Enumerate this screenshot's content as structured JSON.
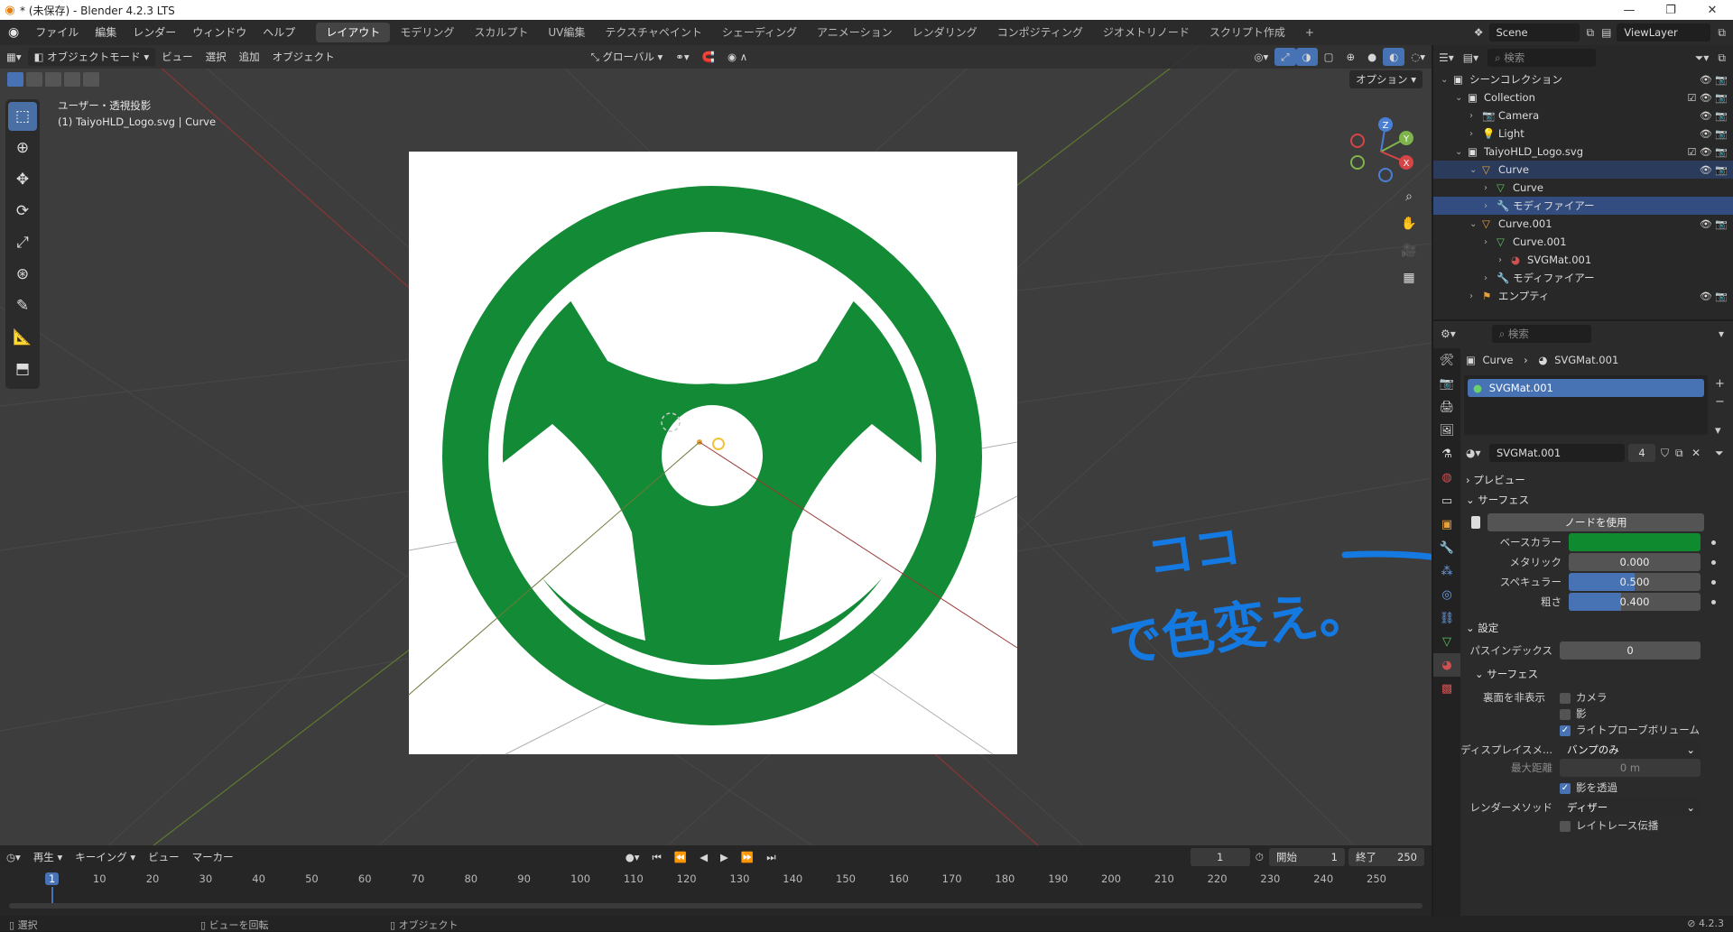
{
  "window": {
    "title": "* (未保存) - Blender 4.2.3 LTS",
    "minimize": "—",
    "maximize": "❐",
    "close": "✕"
  },
  "menu": {
    "items": [
      "ファイル",
      "編集",
      "レンダー",
      "ウィンドウ",
      "ヘルプ"
    ]
  },
  "workspaces": [
    "レイアウト",
    "モデリング",
    "スカルプト",
    "UV編集",
    "テクスチャペイント",
    "シェーディング",
    "アニメーション",
    "レンダリング",
    "コンポジティング",
    "ジオメトリノード",
    "スクリプト作成",
    "+"
  ],
  "scene": {
    "scene_name": "Scene",
    "view_layer": "ViewLayer"
  },
  "viewport": {
    "mode": "オブジェクトモード",
    "menus": [
      "ビュー",
      "選択",
      "追加",
      "オブジェクト"
    ],
    "transform_orientation": "グローバル",
    "options_label": "オプション",
    "view_name": "ユーザー・透視投影",
    "object_info": "(1) TaiyoHLD_Logo.svg | Curve",
    "logo_color": "#138a36",
    "gizmo": {
      "z": "Z",
      "y": "Y",
      "x": "X"
    }
  },
  "outliner": {
    "search_placeholder": "検索",
    "rows": [
      {
        "label": "シーンコレクション",
        "indent": 0,
        "icon": "collection-icon"
      },
      {
        "label": "Collection",
        "indent": 1,
        "icon": "collection-icon"
      },
      {
        "label": "Camera",
        "indent": 2,
        "icon": "camera-icon"
      },
      {
        "label": "Light",
        "indent": 2,
        "icon": "light-icon"
      },
      {
        "label": "TaiyoHLD_Logo.svg",
        "indent": 1,
        "icon": "collection-icon"
      },
      {
        "label": "Curve",
        "indent": 2,
        "icon": "curve-icon",
        "state": "active"
      },
      {
        "label": "Curve",
        "indent": 3,
        "icon": "curve-data-icon"
      },
      {
        "label": "モディファイアー",
        "indent": 3,
        "icon": "wrench-icon",
        "state": "selected"
      },
      {
        "label": "Curve.001",
        "indent": 2,
        "icon": "curve-icon"
      },
      {
        "label": "Curve.001",
        "indent": 3,
        "icon": "curve-data-icon"
      },
      {
        "label": "SVGMat.001",
        "indent": 4,
        "icon": "material-icon"
      },
      {
        "label": "モディファイアー",
        "indent": 3,
        "icon": "wrench-icon"
      },
      {
        "label": "エンプティ",
        "indent": 2,
        "icon": "empty-icon"
      }
    ]
  },
  "properties": {
    "search_placeholder": "検索",
    "breadcrumb": {
      "object": "Curve",
      "material": "SVGMat.001"
    },
    "material_slot": "SVGMat.001",
    "material_name": "SVGMat.001",
    "users": "4",
    "panels": {
      "preview": "プレビュー",
      "surface": "サーフェス",
      "settings": "設定",
      "surface_sub": "サーフェス"
    },
    "use_nodes": "ノードを使用",
    "base_color_label": "ベースカラー",
    "base_color": "#0f8a2e",
    "metallic": {
      "label": "メタリック",
      "value": "0.000",
      "fraction": 0.0
    },
    "specular": {
      "label": "スペキュラー",
      "value": "0.500",
      "fraction": 0.5
    },
    "roughness": {
      "label": "粗さ",
      "value": "0.400",
      "fraction": 0.4
    },
    "pass_index": {
      "label": "パスインデックス",
      "value": "0"
    },
    "backface": {
      "label": "裏面を非表示",
      "camera": "カメラ",
      "shadow": "影",
      "light_probe": "ライトプローブボリューム"
    },
    "displacement": {
      "label": "ディスプレイスメ...",
      "value": "バンプのみ"
    },
    "max_distance": {
      "label": "最大距離",
      "value": "0 m"
    },
    "transparent_shadow": "影を透過",
    "render_method": {
      "label": "レンダーメソッド",
      "value": "ディザー"
    },
    "raytrace": "レイトレース伝播"
  },
  "annotation": {
    "line1": "ココ",
    "line2": "で色変え。",
    "color": "#1479e0"
  },
  "timeline": {
    "menus": [
      "再生",
      "キーイング",
      "ビュー",
      "マーカー"
    ],
    "current_frame": "1",
    "start_label": "開始",
    "start": "1",
    "end_label": "終了",
    "end": "250",
    "ticks": [
      "1",
      "10",
      "20",
      "30",
      "40",
      "50",
      "60",
      "70",
      "80",
      "90",
      "100",
      "110",
      "120",
      "130",
      "140",
      "150",
      "160",
      "170",
      "180",
      "190",
      "200",
      "210",
      "220",
      "230",
      "240",
      "250"
    ]
  },
  "status": {
    "select": "選択",
    "rotate": "ビューを回転",
    "object": "オブジェクト",
    "version": "4.2.3"
  }
}
